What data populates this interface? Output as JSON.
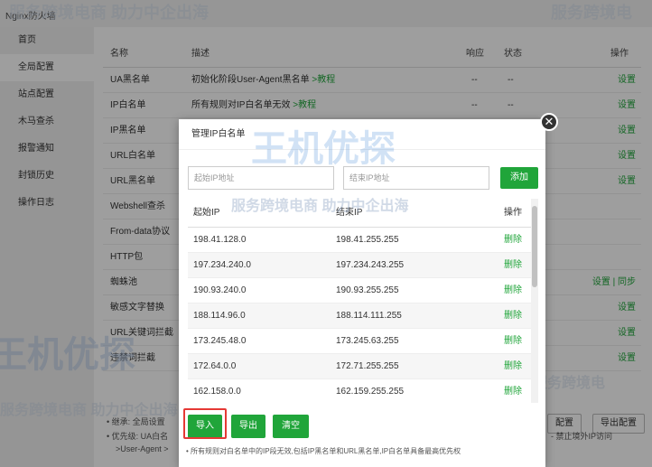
{
  "app": {
    "title": "Nginx防火墙"
  },
  "sidebar": {
    "items": [
      {
        "label": "首页"
      },
      {
        "label": "全局配置"
      },
      {
        "label": "站点配置"
      },
      {
        "label": "木马查杀"
      },
      {
        "label": "报警通知"
      },
      {
        "label": "封锁历史"
      },
      {
        "label": "操作日志"
      }
    ],
    "active_index": 1
  },
  "table": {
    "headers": {
      "name": "名称",
      "desc": "描述",
      "response": "响应",
      "status": "状态",
      "action": "操作"
    },
    "rows": [
      {
        "name": "UA黑名单",
        "desc": "初始化阶段User-Agent黑名单",
        "link": ">教程",
        "response": "--",
        "status": "--",
        "action": "设置"
      },
      {
        "name": "IP白名单",
        "desc": "所有规则对IP白名单无效",
        "link": ">教程",
        "response": "--",
        "status": "--",
        "action": "设置"
      },
      {
        "name": "IP黑名单",
        "desc": "",
        "link": "",
        "response": "",
        "status": "",
        "action": "设置"
      },
      {
        "name": "URL白名单",
        "desc": "",
        "link": "",
        "response": "",
        "status": "",
        "action": "设置"
      },
      {
        "name": "URL黑名单",
        "desc": "",
        "link": "",
        "response": "",
        "status": "",
        "action": "设置"
      },
      {
        "name": "Webshell查杀",
        "desc": "",
        "link": "",
        "response": "",
        "status": "",
        "action": ""
      },
      {
        "name": "From-data协议",
        "desc": "",
        "link": "",
        "response": "",
        "status": "",
        "action": ""
      },
      {
        "name": "HTTP包",
        "desc": "",
        "link": "",
        "response": "",
        "status": "",
        "action": ""
      },
      {
        "name": "蜘蛛池",
        "desc": "",
        "link": "",
        "response": "",
        "status": "",
        "action": "设置 | 同步"
      },
      {
        "name": "敏感文字替换",
        "desc": "",
        "link": "",
        "response": "",
        "status": "",
        "action": "设置"
      },
      {
        "name": "URL关键词拦截",
        "desc": "",
        "link": "",
        "response": "",
        "status": "",
        "action": "设置"
      },
      {
        "name": "违禁词拦截",
        "desc": "",
        "link": "",
        "response": "",
        "status": "",
        "action": "设置"
      }
    ]
  },
  "footer": {
    "line1": "• 继承: 全局设置",
    "line2": "• 优先级: UA白名",
    "line2_right": "- 禁止境外IP访问",
    "line3": ">User-Agent >",
    "import_config": "配置",
    "export_config": "导出配置"
  },
  "dialog": {
    "title": "管理IP白名单",
    "start_placeholder": "起始IP地址",
    "end_placeholder": "结束IP地址",
    "add_label": "添加",
    "columns": {
      "start": "起始IP",
      "end": "结束IP",
      "action": "操作"
    },
    "rows": [
      {
        "start": "198.41.128.0",
        "end": "198.41.255.255",
        "action": "删除"
      },
      {
        "start": "197.234.240.0",
        "end": "197.234.243.255",
        "action": "删除"
      },
      {
        "start": "190.93.240.0",
        "end": "190.93.255.255",
        "action": "删除"
      },
      {
        "start": "188.114.96.0",
        "end": "188.114.111.255",
        "action": "删除"
      },
      {
        "start": "173.245.48.0",
        "end": "173.245.63.255",
        "action": "删除"
      },
      {
        "start": "172.64.0.0",
        "end": "172.71.255.255",
        "action": "删除"
      },
      {
        "start": "162.158.0.0",
        "end": "162.159.255.255",
        "action": "删除"
      }
    ],
    "import_label": "导入",
    "export_label": "导出",
    "clear_label": "清空",
    "note": "• 所有规则对白名单中的IP段无效,包括IP黑名单和URL黑名单,IP白名单具备最高优先权"
  },
  "watermark": {
    "text": "服务跨境电商 助力中企出海",
    "brand": "王机优探",
    "right_text": "服务跨境电"
  },
  "colors": {
    "accent": "#20a53a",
    "highlight": "#e53935"
  }
}
